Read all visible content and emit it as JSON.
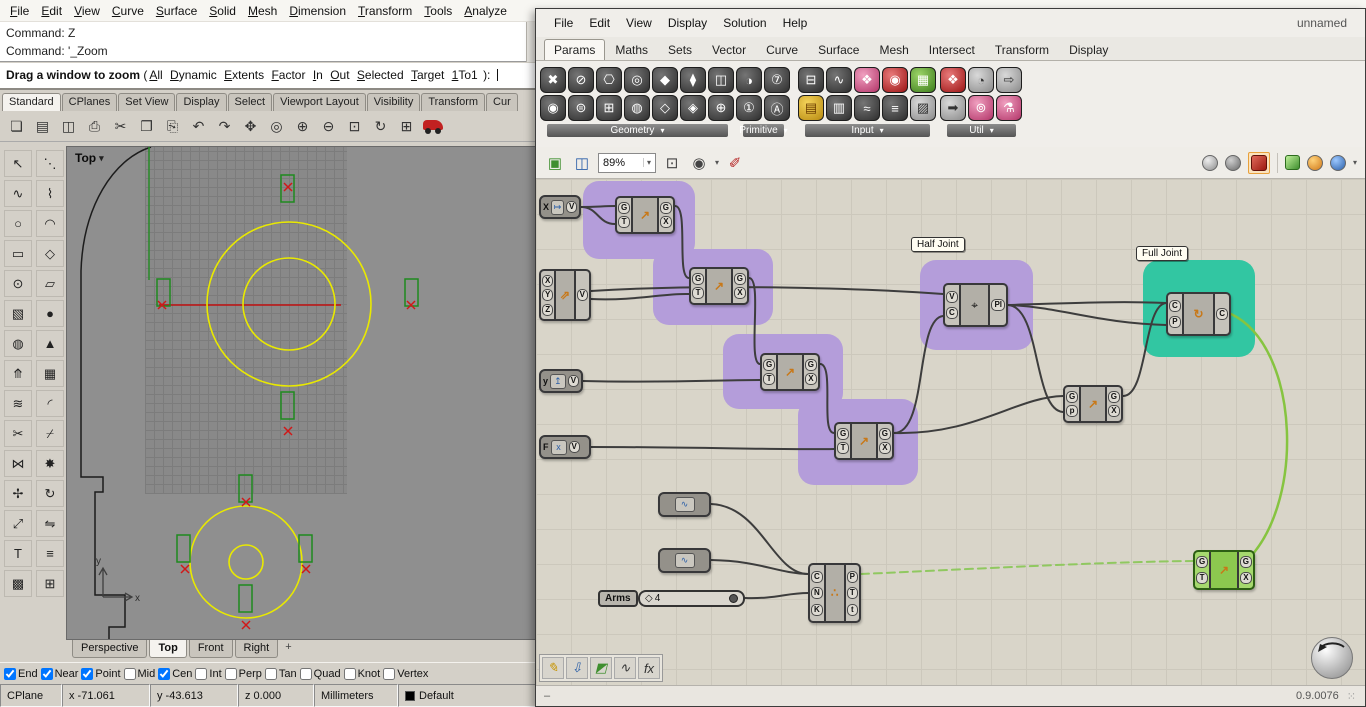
{
  "rhino": {
    "menu": [
      "File",
      "Edit",
      "View",
      "Curve",
      "Surface",
      "Solid",
      "Mesh",
      "Dimension",
      "Transform",
      "Tools",
      "Analyze"
    ],
    "command_history": [
      "Command: Z",
      "Command: '_Zoom"
    ],
    "prompt": {
      "label": "Drag a window to zoom",
      "open": "(",
      "options": [
        "All",
        "Dynamic",
        "Extents",
        "Factor",
        "In",
        "Out",
        "Selected",
        "Target",
        "1To1"
      ],
      "close": "):"
    },
    "toolbar_tabs": [
      "Standard",
      "CPlanes",
      "Set View",
      "Display",
      "Select",
      "Viewport Layout",
      "Visibility",
      "Transform",
      "Cur"
    ],
    "toolbar_icons": [
      "❏",
      "▤",
      "◫",
      "⎙",
      "✂",
      "❐",
      "⎘",
      "↶",
      "↷",
      "✥",
      "◎",
      "⊕",
      "⊖",
      "⊡",
      "↻",
      "⊞"
    ],
    "palette_icons": [
      "↖",
      "⋱",
      "∿",
      "⌇",
      "○",
      "◠",
      "▭",
      "◇",
      "⊙",
      "▱",
      "▧",
      "●",
      "◍",
      "▲",
      "⤊",
      "▦",
      "≋",
      "◜",
      "✂",
      "⌿",
      "⋈",
      "✸",
      "✢",
      "↻",
      "⤢",
      "⇋",
      "T",
      "≡",
      "▩",
      "⊞"
    ],
    "viewport": {
      "title": "Top",
      "axis_x": "x",
      "axis_y": "y"
    },
    "viewport_tabs": [
      "Perspective",
      "Top",
      "Front",
      "Right"
    ],
    "viewport_new_tab": "+",
    "osnap_items": [
      {
        "label": "End",
        "checked": true
      },
      {
        "label": "Near",
        "checked": true
      },
      {
        "label": "Point",
        "checked": true
      },
      {
        "label": "Mid",
        "checked": false
      },
      {
        "label": "Cen",
        "checked": true
      },
      {
        "label": "Int",
        "checked": false
      },
      {
        "label": "Perp",
        "checked": false
      },
      {
        "label": "Tan",
        "checked": false
      },
      {
        "label": "Quad",
        "checked": false
      },
      {
        "label": "Knot",
        "checked": false
      },
      {
        "label": "Vertex",
        "checked": false
      }
    ],
    "status": {
      "cplane": "CPlane",
      "x": "x -71.061",
      "y": "y -43.613",
      "z": "z 0.000",
      "units": "Millimeters",
      "layer": "Default"
    }
  },
  "gh": {
    "menu": [
      "File",
      "Edit",
      "View",
      "Display",
      "Solution",
      "Help"
    ],
    "doc_title": "unnamed",
    "tabs": [
      "Params",
      "Maths",
      "Sets",
      "Vector",
      "Curve",
      "Surface",
      "Mesh",
      "Intersect",
      "Transform",
      "Display"
    ],
    "palette": {
      "groups": [
        "Geometry",
        "Primitive",
        "Input",
        "Util"
      ],
      "geometry_icons": [
        "✖",
        "◉",
        "⊘",
        "⊜",
        "⎔",
        "⊞",
        "◎",
        "◍",
        "◆",
        "◇",
        "⧫",
        "◈",
        "◫",
        "⊕"
      ],
      "primitive_icons": [
        "◑",
        "①",
        "⑦",
        "Ⓐ"
      ],
      "input_icons": [
        "⊟",
        "▤",
        "∿",
        "▥",
        "❖",
        "≈",
        "◉",
        "≡",
        "▦",
        "▨"
      ],
      "util_icons": [
        "❖",
        "➡",
        "◔",
        "⊚",
        "⇨",
        "⚗"
      ]
    },
    "canvasbar": {
      "zoom": "89%"
    },
    "canvas": {
      "group_labels": {
        "half": "Half Joint",
        "full": "Full Joint"
      },
      "slider": {
        "label": "Arms",
        "marker": "◇",
        "value": "4"
      },
      "icons": {
        "move": "↗",
        "plane": "⌖",
        "orient": "↻",
        "divide": "∴",
        "pill": "∿",
        "vec": "⇗"
      },
      "params": {
        "x": {
          "label": "X",
          "icon": "↦",
          "out": "V"
        },
        "y": {
          "label": "y",
          "icon": "↥",
          "out": "V"
        },
        "f": {
          "label": "F",
          "icon": "x",
          "out": "V"
        }
      },
      "ports": {
        "vec_in": [
          "X",
          "Y",
          "Z"
        ],
        "vec_out": "V",
        "move_in": [
          "G",
          "T"
        ],
        "move_out": [
          "G",
          "X"
        ],
        "move5_in": [
          "G",
          "p"
        ],
        "half_in": [
          "V",
          "C"
        ],
        "half_out": "Pl",
        "full_in": [
          "C",
          "P"
        ],
        "full_out": "C",
        "div_in": [
          "C",
          "N",
          "K"
        ],
        "div_out": [
          "P",
          "T",
          "t"
        ]
      }
    },
    "dock_icons": [
      "✎",
      "⇩",
      "◩",
      "∿",
      "fx"
    ],
    "statusbar": {
      "dash": "–",
      "version": "0.9.0076"
    }
  }
}
